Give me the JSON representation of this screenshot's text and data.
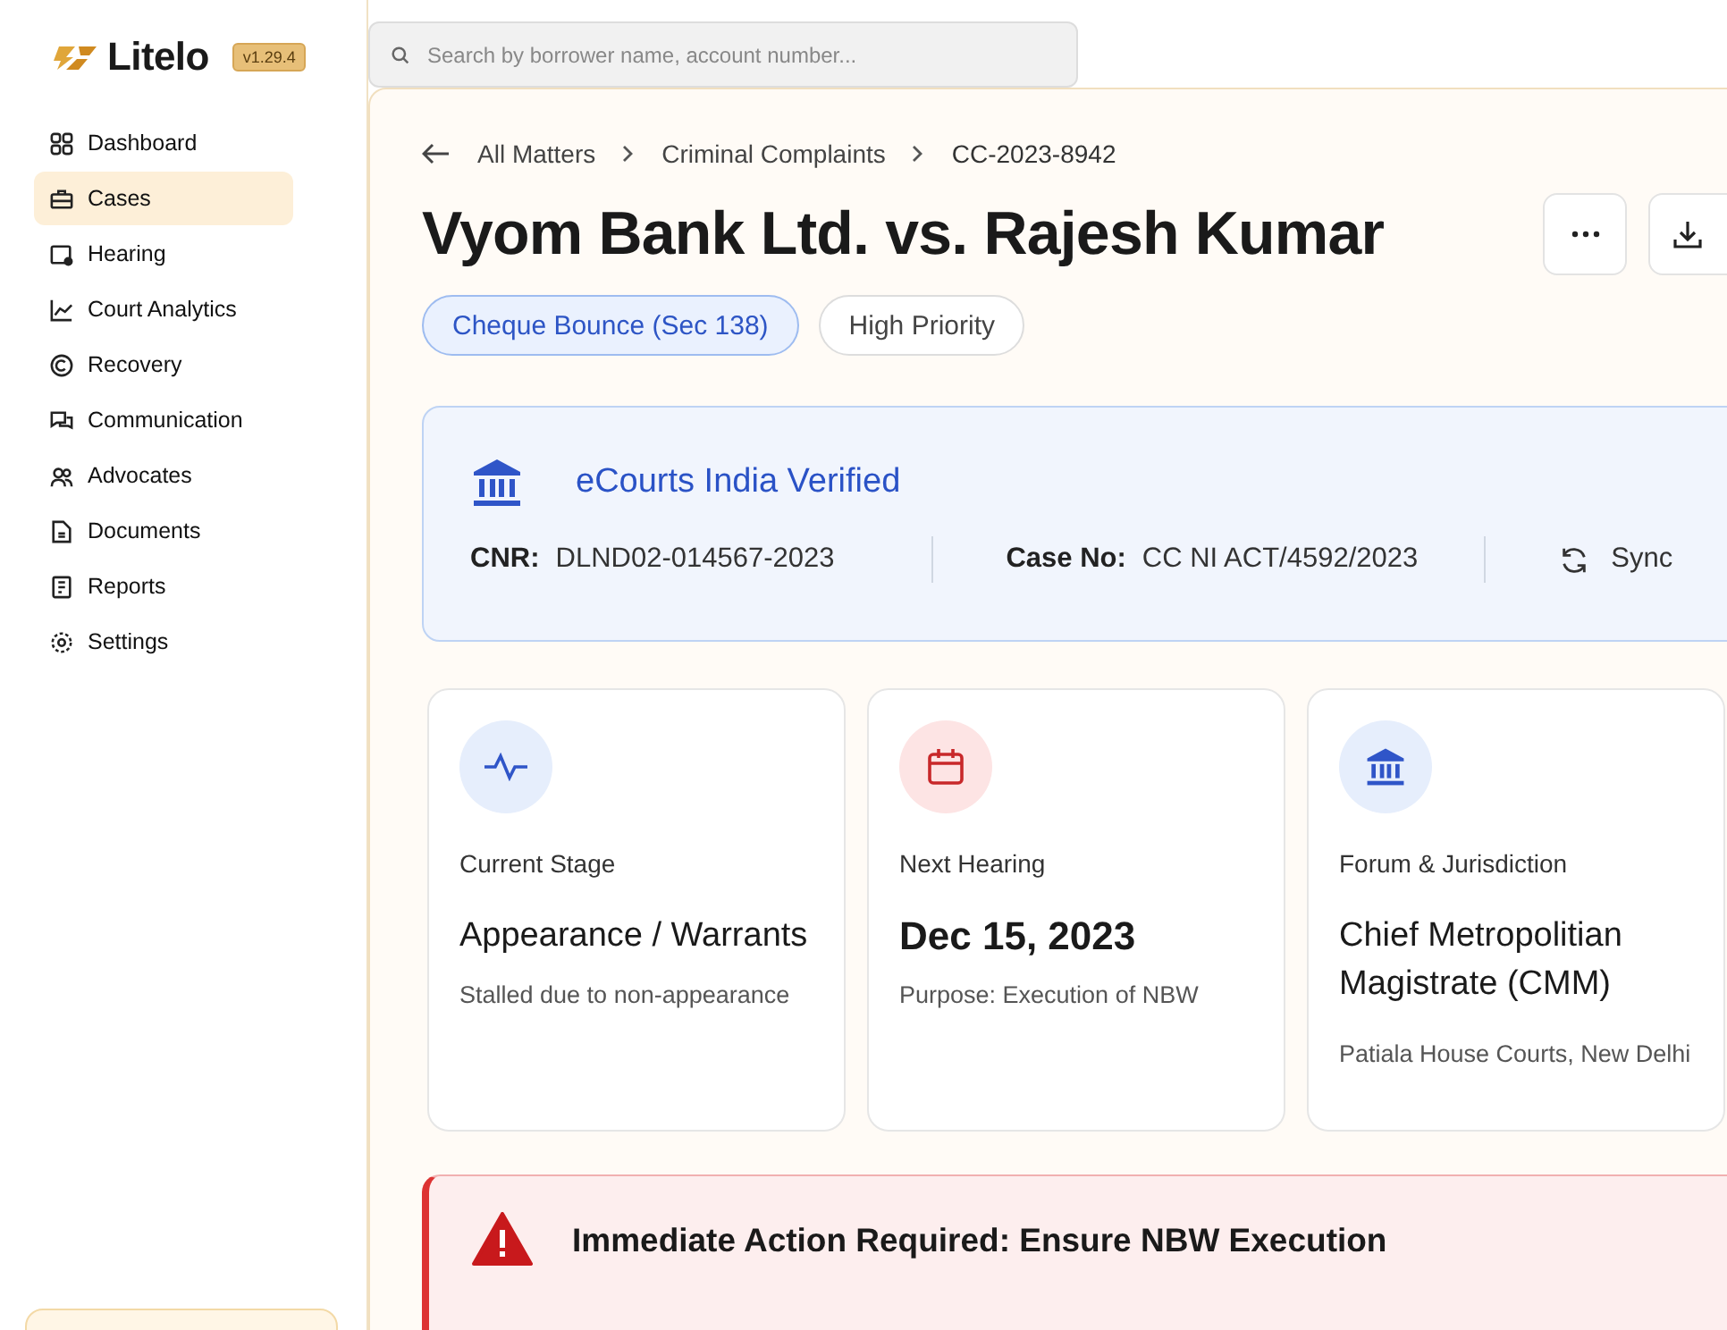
{
  "brand": {
    "name": "Litelo",
    "version": "v1.29.4"
  },
  "search": {
    "placeholder": "Search by borrower name, account number..."
  },
  "sidebar": {
    "items": [
      {
        "label": "Dashboard",
        "selected": false
      },
      {
        "label": "Cases",
        "selected": true
      },
      {
        "label": "Hearing",
        "selected": false
      },
      {
        "label": "Court Analytics",
        "selected": false
      },
      {
        "label": "Recovery",
        "selected": false
      },
      {
        "label": "Communication",
        "selected": false
      },
      {
        "label": "Advocates",
        "selected": false
      },
      {
        "label": "Documents",
        "selected": false
      },
      {
        "label": "Reports",
        "selected": false
      },
      {
        "label": "Settings",
        "selected": false
      }
    ]
  },
  "breadcrumb": [
    "All Matters",
    "Criminal Complaints",
    "CC-2023-8942"
  ],
  "title": "Vyom Bank Ltd. vs. Rajesh Kumar",
  "tags": [
    {
      "label": "Cheque Bounce (Sec 138)",
      "kind": "category"
    },
    {
      "label": "High Priority",
      "kind": "plain"
    }
  ],
  "verification": {
    "title": "eCourts India Verified",
    "fields": [
      {
        "label": "CNR:",
        "value": "DLND02-014567-2023"
      },
      {
        "label": "Case No:",
        "value": "CC NI ACT/4592/2023"
      }
    ],
    "sync": "Sync"
  },
  "cards": [
    {
      "kind": "stage",
      "label": "Current Stage",
      "value": "Appearance / Warrants",
      "note": "Stalled due to non-appearance"
    },
    {
      "kind": "hearing",
      "label": "Next Hearing",
      "value": "Dec 15, 2023",
      "note": "Purpose: Execution of NBW"
    },
    {
      "kind": "forum",
      "label": "Forum & Jurisdiction",
      "value": "Chief Metropolitian Magistrate (CMM)",
      "note": "Patiala House Courts, New Delhi"
    }
  ],
  "alert": {
    "title": "Immediate Action Required: Ensure NBW Execution"
  }
}
